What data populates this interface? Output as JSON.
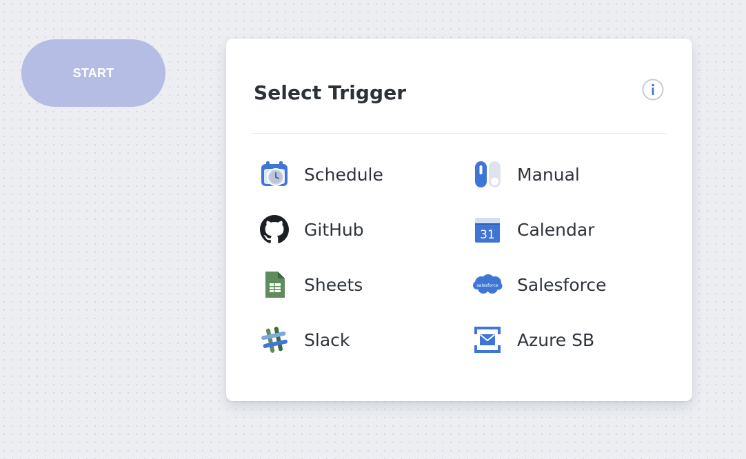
{
  "canvas": {
    "start_node": {
      "label": "START",
      "color": "#b6bde4"
    }
  },
  "panel": {
    "title": "Select Trigger",
    "info_icon": "info-circle-icon",
    "triggers": [
      {
        "label": "Schedule",
        "icon": "schedule-clock-icon"
      },
      {
        "label": "Manual",
        "icon": "manual-toggle-icon"
      },
      {
        "label": "GitHub",
        "icon": "github-icon"
      },
      {
        "label": "Calendar",
        "icon": "calendar-icon",
        "icon_text": "31"
      },
      {
        "label": "Sheets",
        "icon": "sheets-icon"
      },
      {
        "label": "Salesforce",
        "icon": "salesforce-icon",
        "icon_text": "salesforce"
      },
      {
        "label": "Slack",
        "icon": "slack-icon"
      },
      {
        "label": "Azure SB",
        "icon": "azure-service-bus-icon"
      }
    ]
  },
  "colors": {
    "canvas_bg": "#eceef2",
    "accent_blue": "#3f76d6",
    "text_dark": "#2f343b"
  }
}
